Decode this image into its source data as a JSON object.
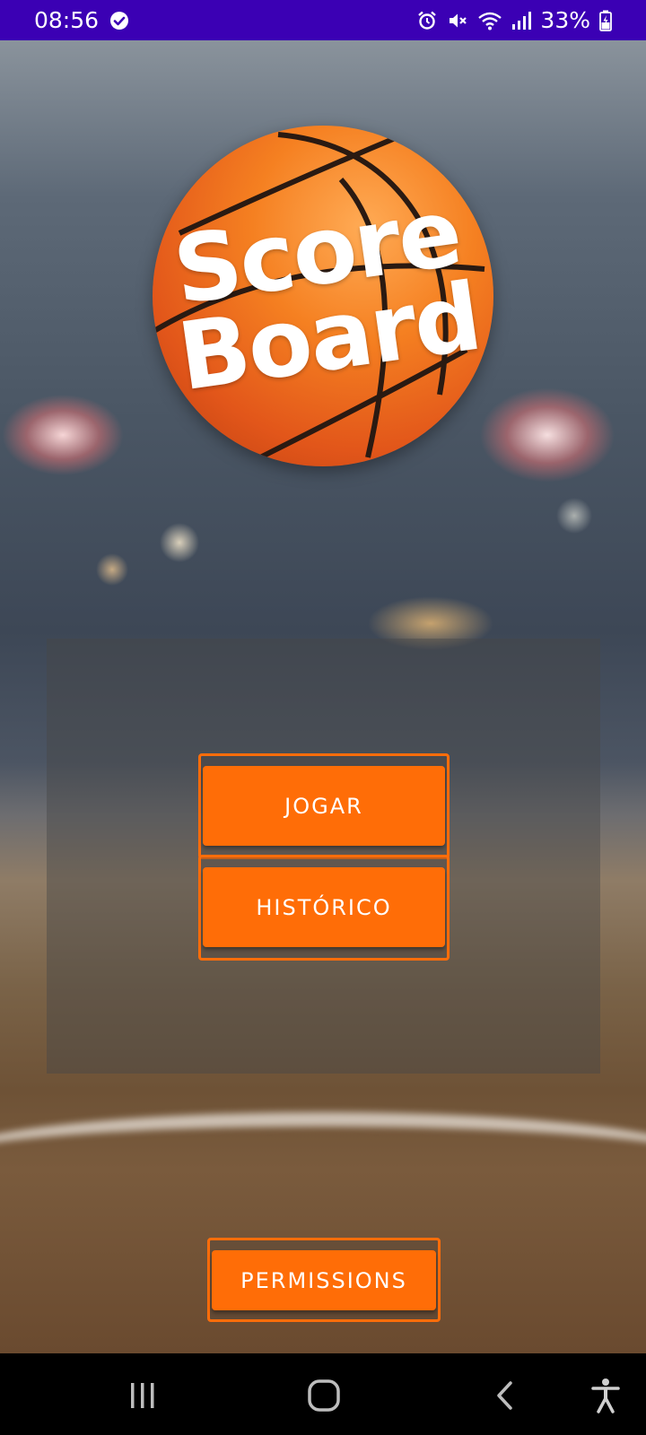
{
  "status_bar": {
    "time": "08:56",
    "battery_percent": "33%",
    "icons": [
      "check-circle-icon",
      "alarm-icon",
      "mute-icon",
      "wifi-icon",
      "signal-icon",
      "battery-charging-icon"
    ]
  },
  "logo": {
    "line1": "Score",
    "line2": "Board"
  },
  "menu": {
    "play_label": "JOGAR",
    "history_label": "HISTÓRICO"
  },
  "footer": {
    "permissions_label": "PERMISSIONS"
  },
  "nav_bar": {
    "icons": [
      "recent-apps-icon",
      "home-icon",
      "back-icon",
      "accessibility-icon"
    ]
  },
  "colors": {
    "status_bar": "#3b00b4",
    "button": "#ff6d07",
    "button_border": "#ff6d0a"
  }
}
